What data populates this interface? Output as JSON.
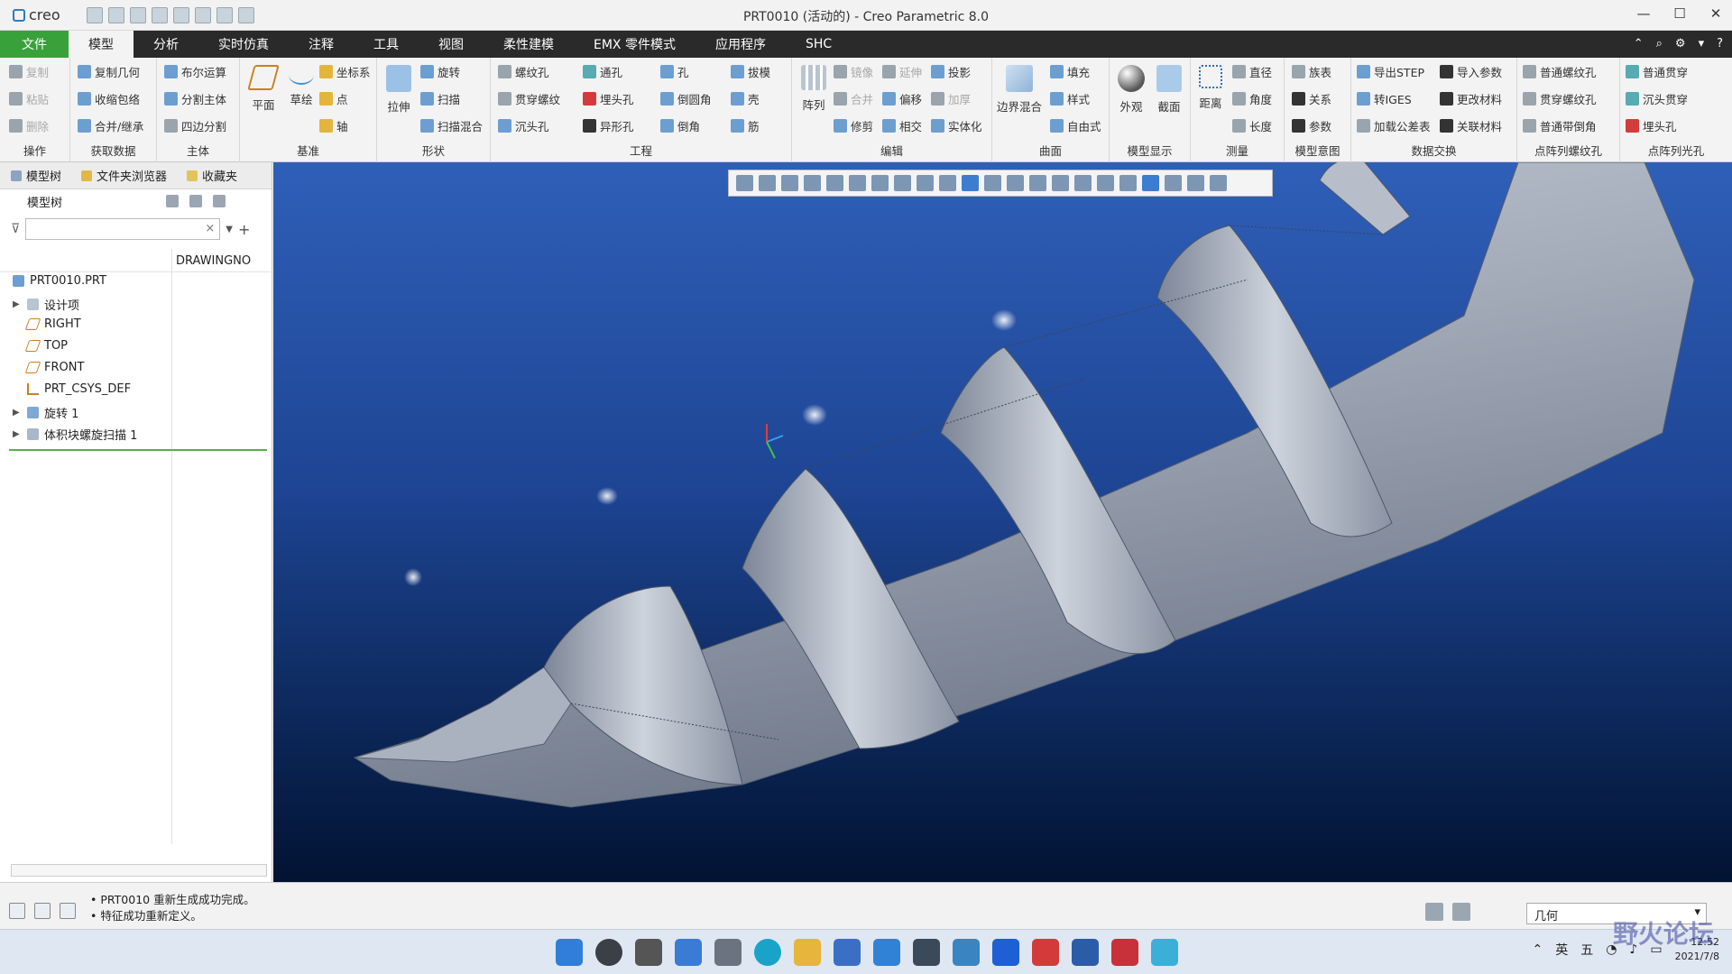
{
  "app": {
    "logo": "creo",
    "window_title": "PRT0010 (活动的) - Creo Parametric 8.0",
    "controls": [
      "—",
      "☐",
      "✕"
    ]
  },
  "tabs": [
    "文件",
    "模型",
    "分析",
    "实时仿真",
    "注释",
    "工具",
    "视图",
    "柔性建模",
    "EMX 零件模式",
    "应用程序",
    "SHC"
  ],
  "tabs_right": [
    "⌃",
    "⌕",
    "⚙",
    "▾",
    "?"
  ],
  "ribbon": {
    "ops": {
      "items": [
        "复制",
        "粘贴",
        "删除"
      ],
      "title": "操作"
    },
    "get_data": {
      "items": [
        "复制几何",
        "收缩包络",
        "合并/继承"
      ],
      "title": "获取数据"
    },
    "body": {
      "items": [
        "布尔运算",
        "分割主体",
        "四边分割"
      ],
      "title": "主体"
    },
    "datum": {
      "big": [
        "平面",
        "草绘"
      ],
      "items": [
        "坐标系",
        "点",
        "轴"
      ],
      "title": "基准"
    },
    "shape": {
      "big": "拉伸",
      "items": [
        "旋转",
        "扫描",
        "扫描混合"
      ],
      "title": "形状"
    },
    "eng": {
      "col1": [
        "螺纹孔",
        "贯穿螺纹",
        "沉头孔"
      ],
      "col2": [
        "通孔",
        "埋头孔",
        "异形孔"
      ],
      "col3": [
        "孔",
        "倒圆角",
        "倒角"
      ],
      "col4": [
        "拔模",
        "壳",
        "筋"
      ],
      "title": "工程"
    },
    "edit": {
      "big": "阵列",
      "col1": [
        "镜像",
        "合并",
        "修剪"
      ],
      "col2": [
        "延伸",
        "偏移",
        "相交"
      ],
      "col3": [
        "投影",
        "加厚",
        "实体化"
      ],
      "title": "编辑"
    },
    "surface": {
      "big": "边界混合",
      "items": [
        "填充",
        "样式",
        "自由式"
      ],
      "title": "曲面"
    },
    "display": {
      "big": [
        "外观",
        "截面"
      ],
      "title": "模型显示"
    },
    "measure": {
      "big": "距离",
      "items": [
        "直径",
        "角度",
        "长度"
      ],
      "title": "测量"
    },
    "intent": {
      "items": [
        "族表",
        "关系",
        "参数"
      ],
      "title": "模型意图"
    },
    "exchange": {
      "col1": [
        "导出STEP",
        "转IGES",
        "加载公差表"
      ],
      "col2": [
        "导入参数",
        "更改材料",
        "关联材料"
      ],
      "title": "数据交换"
    },
    "point_thread": {
      "items": [
        "普通螺纹孔",
        "贯穿螺纹孔",
        "普通带倒角"
      ],
      "title": "点阵列螺纹孔"
    },
    "point_light": {
      "items": [
        "普通贯穿",
        "沉头贯穿",
        "埋头孔"
      ],
      "title": "点阵列光孔"
    }
  },
  "panel": {
    "tabs": [
      "模型树",
      "文件夹浏览器",
      "收藏夹"
    ],
    "tree_label": "模型树",
    "column": "DRAWINGNO",
    "items": [
      "PRT0010.PRT",
      "设计项",
      "RIGHT",
      "TOP",
      "FRONT",
      "PRT_CSYS_DEF",
      "旋转 1",
      "体积块螺旋扫描 1"
    ]
  },
  "status": {
    "messages": [
      "PRT0010 重新生成成功完成。",
      "特征成功重新定义。"
    ],
    "selector": "几何"
  },
  "tray": {
    "lang": "英",
    "ime": "五",
    "time": "12:52",
    "date": "2021/7/8"
  },
  "watermark": "野火论坛",
  "colors": {
    "file_tab": "#38a13a",
    "viewport_top": "#2f5fb8",
    "viewport_bottom": "#021332",
    "part": "#9aa3b2"
  }
}
